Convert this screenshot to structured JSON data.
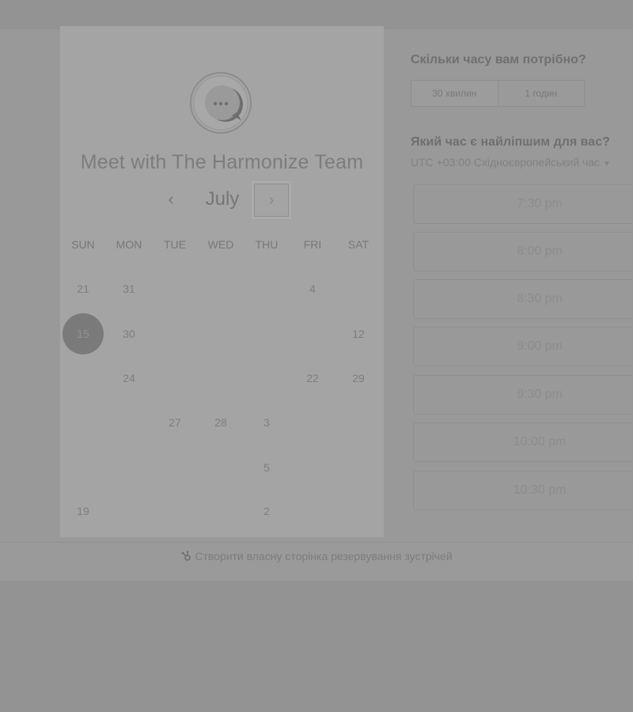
{
  "booking": {
    "title": "Meet with The Harmonize Team",
    "logo_icon": "chat-bubble-icon"
  },
  "calendar": {
    "month": "July",
    "prev_icon": "chevron-left-icon",
    "prev_glyph": "‹",
    "next_icon": "chevron-right-icon",
    "next_glyph": "›",
    "weekdays": [
      "SUN",
      "MON",
      "TUE",
      "WED",
      "THU",
      "FRI",
      "SAT"
    ],
    "days": {
      "r1c1": "21",
      "r1c2": "31",
      "r1c6": "4",
      "r2c1": "15",
      "r2c2": "30",
      "r2c7": "12",
      "r3c2": "24",
      "r3c6": "22",
      "r3c7": "29",
      "r4c3": "27",
      "r4c4": "28",
      "r4c5": "3",
      "r5c5": "5",
      "r6c1": "19",
      "r6c5": "2"
    },
    "selected_day": "15"
  },
  "duration": {
    "question": "Скільки часу вам потрібно?",
    "options": [
      "30 хвилин",
      "1 годин"
    ]
  },
  "times": {
    "question": "Який час є найліпшим для вас?",
    "timezone": "UTC +03:00 Східноєвропейський час",
    "timezone_caret": "▼",
    "slots": [
      "7:30 pm",
      "8:00 pm",
      "8:30 pm",
      "9:00 pm",
      "9:30 pm",
      "10:00 pm",
      "10:30 pm"
    ]
  },
  "footer": {
    "link_text": "Створити власну сторінка резервування зустрічей",
    "icon": "sprocket-icon"
  },
  "colors": {
    "overlay": "#939393",
    "card": "#a4a4a4",
    "selected_day": "#7a7a7a"
  }
}
